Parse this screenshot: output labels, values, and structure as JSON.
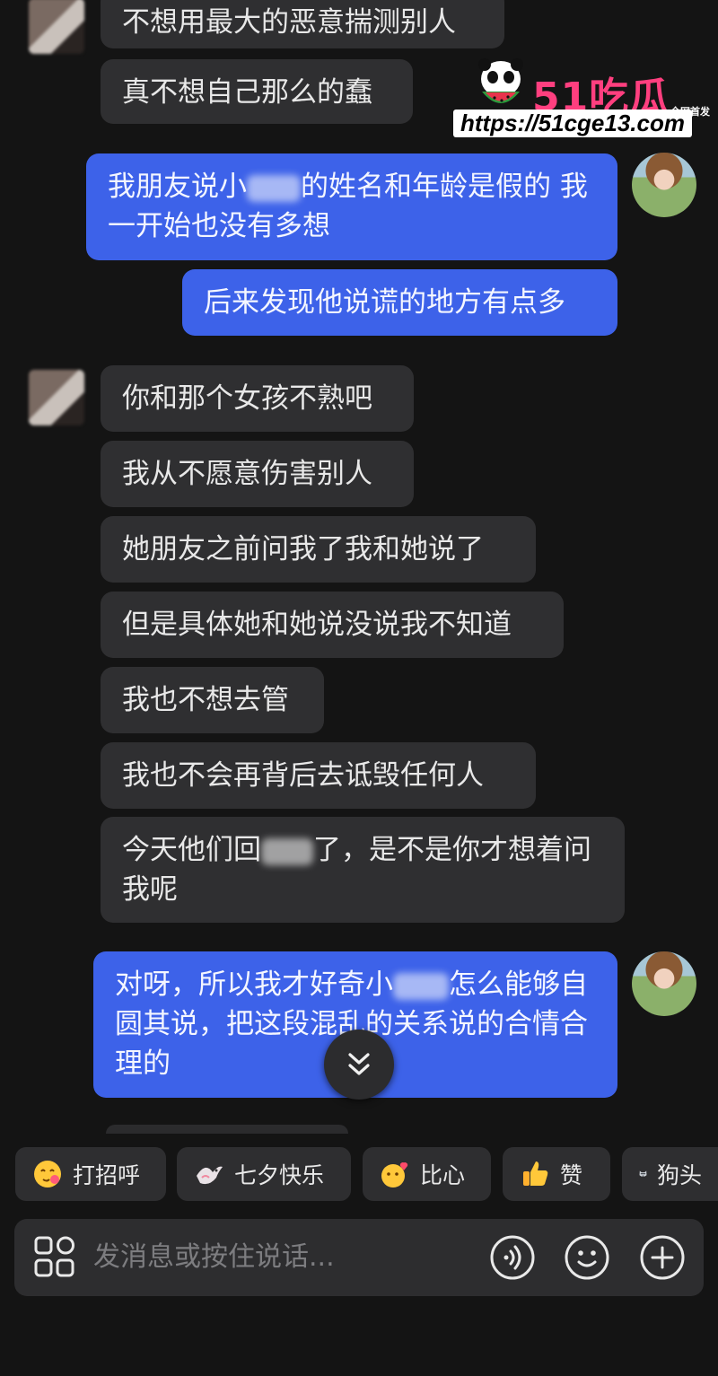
{
  "messages": {
    "m1": "不想用最大的恶意揣测别人",
    "m2": "真不想自己那么的蠢",
    "m3a": "我朋友说小",
    "m3b": "的姓名和年龄是假的 我一开始也没有多想",
    "m4": "后来发现他说谎的地方有点多",
    "m5": "你和那个女孩不熟吧",
    "m6": "我从不愿意伤害别人",
    "m7": "她朋友之前问我了我和她说了",
    "m8": "但是具体她和她说没说我不知道",
    "m9": "我也不想去管",
    "m10": "我也不会再背后去诋毁任何人",
    "m11a": "今天他们回",
    "m11b": "了，是不是你才想着问我呢",
    "m12a": "对呀，所以我才好奇小",
    "m12b": "怎么能够自圆其说，把这段混乱的关系说的合情合理的"
  },
  "watermark": {
    "title": "51吃瓜",
    "tag": "全网首发",
    "url": "https://51cge13.com"
  },
  "quick_replies": [
    {
      "label": "打招呼"
    },
    {
      "label": "七夕快乐"
    },
    {
      "label": "比心"
    },
    {
      "label": "赞"
    },
    {
      "label": "狗头"
    }
  ],
  "composer": {
    "placeholder": "发消息或按住说话..."
  },
  "colors": {
    "background": "#141414",
    "incoming_bubble": "#2f2f31",
    "outgoing_bubble": "#3d62e9",
    "watermark_pink": "#ff3f7f"
  }
}
